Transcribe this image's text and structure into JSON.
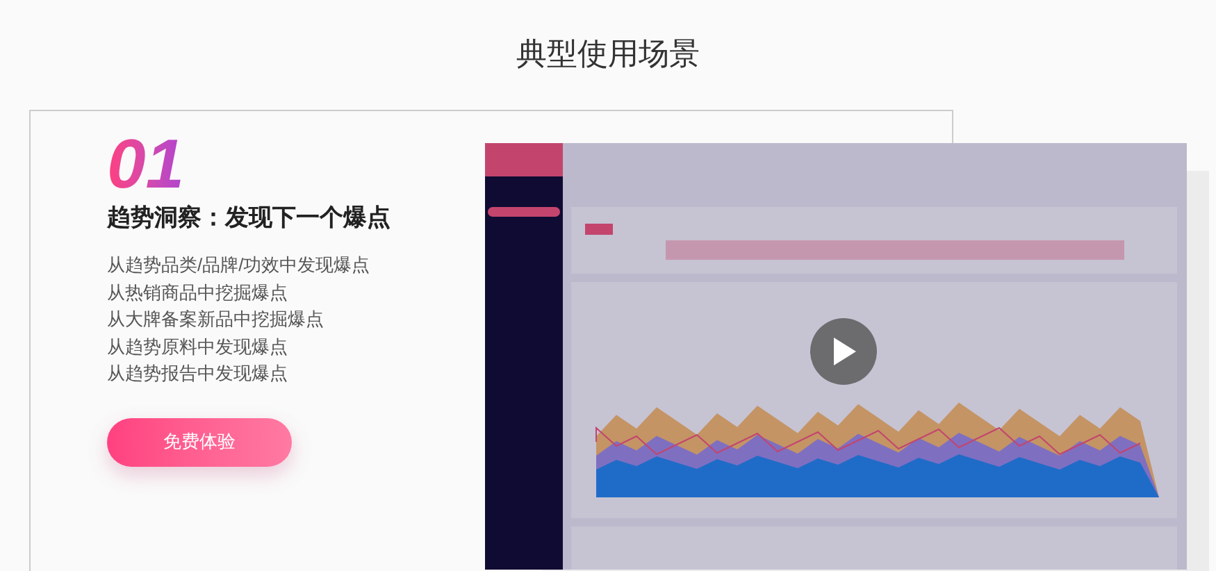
{
  "section_title": "典型使用场景",
  "feature": {
    "number": "01",
    "heading": "趋势洞察：发现下一个爆点",
    "points": [
      "从趋势品类/品牌/功效中发现爆点",
      "从热销商品中挖掘爆点",
      "从大牌备案新品中挖掘爆点",
      "从趋势原料中发现爆点",
      "从趋势报告中发现爆点"
    ],
    "cta": "免费体验"
  }
}
